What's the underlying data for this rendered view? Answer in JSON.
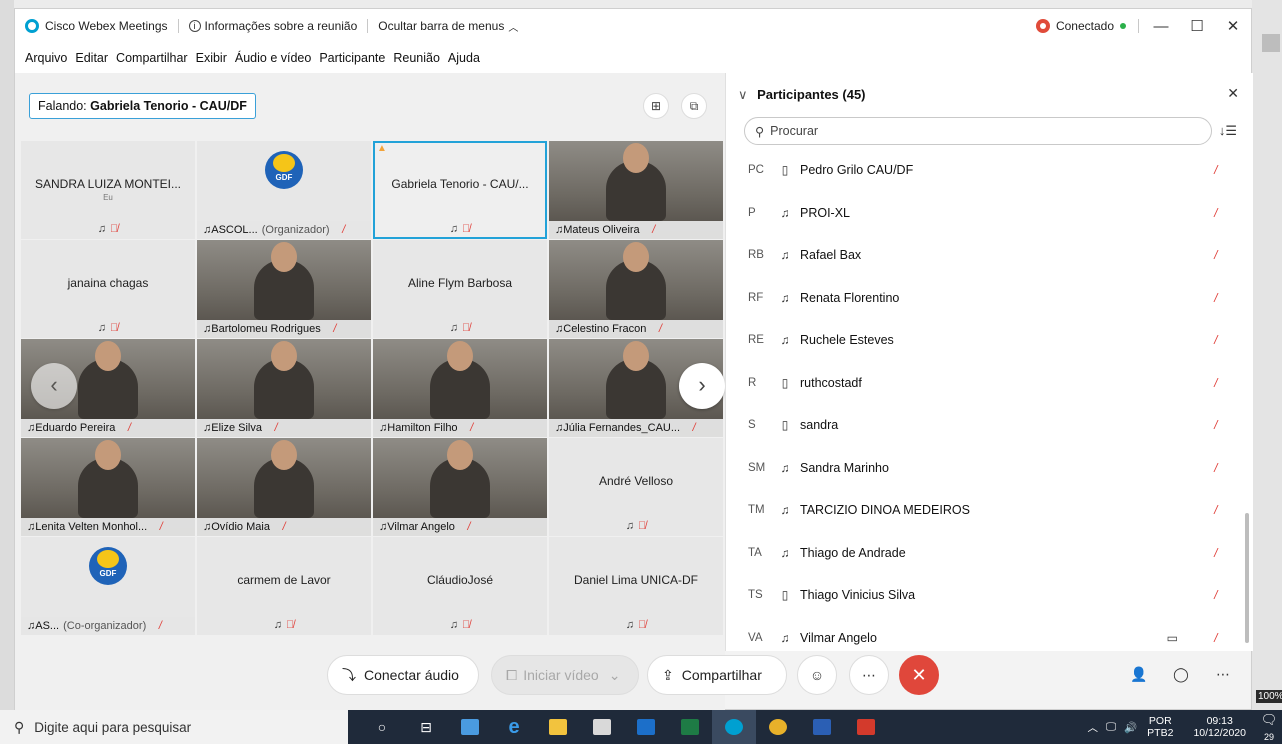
{
  "window": {
    "app_title": "Cisco Webex Meetings",
    "meeting_info": "Informações sobre a reunião",
    "hide_menu": "Ocultar barra de menus",
    "status": "Conectado"
  },
  "menu": [
    "Arquivo",
    "Editar",
    "Compartilhar",
    "Exibir",
    "Áudio e vídeo",
    "Participante",
    "Reunião",
    "Ajuda"
  ],
  "speaking": {
    "label": "Falando:",
    "name": "Gabriela Tenorio - CAU/DF"
  },
  "tiles": [
    {
      "name": "SANDRA LUIZA MONTEI...",
      "sub": "Eu",
      "type": "name"
    },
    {
      "bar": "ASCOL...",
      "org": "(Organizador)",
      "type": "gdf"
    },
    {
      "name": "Gabriela Tenorio - CAU/...",
      "type": "active"
    },
    {
      "bar": "Mateus Oliveira",
      "type": "cam"
    },
    {
      "name": "janaina chagas",
      "type": "name"
    },
    {
      "bar": "Bartolomeu Rodrigues",
      "type": "cam"
    },
    {
      "name": "Aline Flym Barbosa",
      "type": "name"
    },
    {
      "bar": "Celestino Fracon",
      "type": "cam"
    },
    {
      "bar": "Eduardo Pereira",
      "type": "cam"
    },
    {
      "bar": "Elize Silva",
      "type": "cam"
    },
    {
      "bar": "Hamilton Filho",
      "type": "cam"
    },
    {
      "bar": "Júlia Fernandes_CAU...",
      "type": "cam"
    },
    {
      "bar": "Lenita Velten Monhol...",
      "type": "cam"
    },
    {
      "bar": "Ovídio Maia",
      "type": "cam"
    },
    {
      "bar": "Vilmar Angelo",
      "type": "cam"
    },
    {
      "name": "André Velloso",
      "type": "name"
    },
    {
      "bar": "AS...",
      "org": "(Co-organizador)",
      "type": "gdf"
    },
    {
      "name": "carmem de Lavor",
      "type": "name"
    },
    {
      "name": "CláudioJosé",
      "type": "name"
    },
    {
      "name": "Daniel Lima UNICA-DF",
      "type": "name"
    }
  ],
  "gdf_label": "GDF",
  "controls": {
    "connect_audio": "Conectar áudio",
    "start_video": "Iniciar vídeo",
    "share": "Compartilhar"
  },
  "panel": {
    "title": "Participantes (45)",
    "search_placeholder": "Procurar",
    "participants": [
      {
        "ini": "PC",
        "dev": "phone",
        "name": "Pedro Grilo CAU/DF"
      },
      {
        "ini": "P",
        "dev": "headset",
        "name": "PROI-XL"
      },
      {
        "ini": "RB",
        "dev": "headset",
        "name": "Rafael Bax"
      },
      {
        "ini": "RF",
        "dev": "headset",
        "name": "Renata Florentino"
      },
      {
        "ini": "RE",
        "dev": "headset",
        "name": "Ruchele Esteves"
      },
      {
        "ini": "R",
        "dev": "phone",
        "name": "ruthcostadf"
      },
      {
        "ini": "S",
        "dev": "phone",
        "name": "sandra"
      },
      {
        "ini": "SM",
        "dev": "headset",
        "name": "Sandra Marinho"
      },
      {
        "ini": "TM",
        "dev": "headset",
        "name": "TARCIZIO DINOA MEDEIROS"
      },
      {
        "ini": "TA",
        "dev": "headset",
        "name": "Thiago de Andrade"
      },
      {
        "ini": "TS",
        "dev": "phone",
        "name": "Thiago Vinicius Silva"
      },
      {
        "ini": "VA",
        "dev": "headset",
        "name": "Vilmar Angelo",
        "cam": true
      }
    ]
  },
  "taskbar": {
    "search": "Digite aqui para pesquisar",
    "lang1": "POR",
    "lang2": "PTB2",
    "time": "09:13",
    "date": "10/12/2020",
    "notif_count": "29"
  },
  "desktop": {
    "zoom": "100%"
  },
  "colors": {
    "accent": "#22a2d8",
    "end_call": "#e0473b",
    "mute": "#e0403a",
    "taskbar": "#1f2a3a"
  }
}
